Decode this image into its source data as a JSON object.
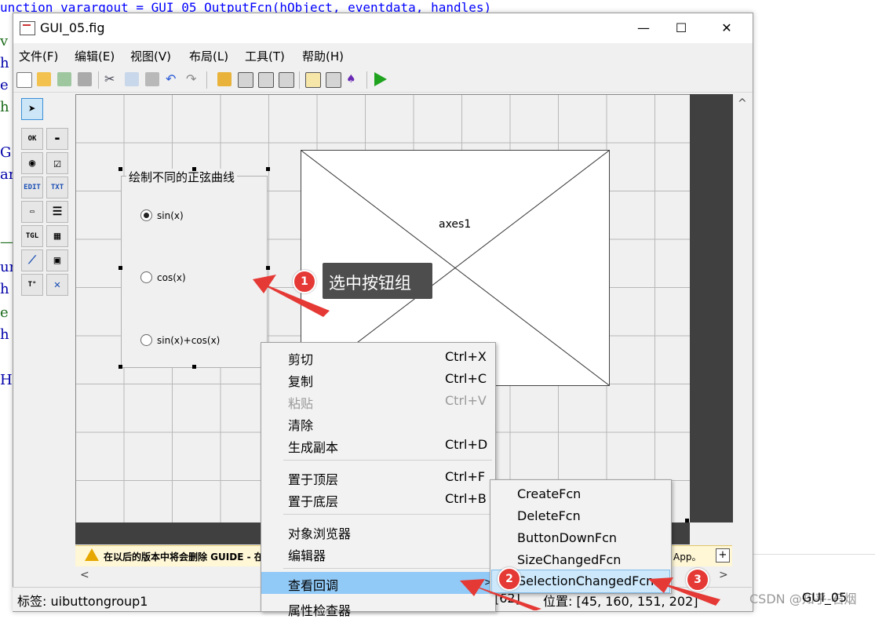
{
  "background_code": {
    "top_line": "unction varargout = GUI_05_OutputFcn(hObject, eventdata, handles)",
    "left_chars": [
      "v",
      "h",
      "e",
      "h",
      "G",
      "ar",
      "—",
      "un",
      "h",
      "e",
      "h",
      "H"
    ]
  },
  "window": {
    "title": "GUI_05.fig",
    "controls": {
      "minimize": "—",
      "maximize": "☐",
      "close": "✕"
    }
  },
  "menubar": {
    "items": [
      "文件(F)",
      "编辑(E)",
      "视图(V)",
      "布局(L)",
      "工具(T)",
      "帮助(H)"
    ]
  },
  "toolbar": {
    "buttons": [
      "new-icon",
      "open-icon",
      "save-as-icon",
      "save-icon",
      "cut-icon",
      "copy-icon",
      "paste-icon",
      "undo-icon",
      "redo-icon",
      "align-icon",
      "menu-editor-icon",
      "tab-order-icon",
      "toolbar-editor-icon",
      "editor-icon",
      "property-inspector-icon",
      "object-browser-icon",
      "run-icon"
    ]
  },
  "palette": {
    "tools": [
      "select",
      "OK",
      "slider",
      "radio",
      "checkbox",
      "EDIT",
      "TXT",
      "popup",
      "listbox",
      "TGL",
      "table",
      "axes",
      "panel",
      "buttongroup",
      "activex"
    ]
  },
  "buttongroup": {
    "title": "绘制不同的正弦曲线",
    "options": [
      {
        "label": "sin(x)",
        "selected": true
      },
      {
        "label": "cos(x)",
        "selected": false
      },
      {
        "label": "sin(x)+cos(x)",
        "selected": false
      }
    ]
  },
  "axes": {
    "label": "axes1"
  },
  "warning": {
    "text": "在以后的版本中将会删除 GUIDE - 在",
    "tail": "App。",
    "plus": "+"
  },
  "statusbar": {
    "tag": "标签: uibuttongroup1",
    "current_snippet": "[62]",
    "position": "位置: [45, 160, 151, 202]"
  },
  "context_menu": {
    "groups": [
      [
        {
          "label": "剪切",
          "key": "Ctrl+X",
          "disabled": false
        },
        {
          "label": "复制",
          "key": "Ctrl+C",
          "disabled": false
        },
        {
          "label": "粘贴",
          "key": "Ctrl+V",
          "disabled": true
        },
        {
          "label": "清除",
          "key": "",
          "disabled": false
        },
        {
          "label": "生成副本",
          "key": "Ctrl+D",
          "disabled": false
        }
      ],
      [
        {
          "label": "置于顶层",
          "key": "Ctrl+F",
          "disabled": false
        },
        {
          "label": "置于底层",
          "key": "Ctrl+B",
          "disabled": false
        }
      ],
      [
        {
          "label": "对象浏览器",
          "key": "",
          "disabled": false
        },
        {
          "label": "编辑器",
          "key": "",
          "disabled": false
        }
      ],
      [
        {
          "label": "查看回调",
          "key": "",
          "disabled": false,
          "highlighted": true,
          "submenu": ">"
        },
        {
          "label": "属性检查器",
          "key": "",
          "disabled": false
        }
      ]
    ]
  },
  "callback_submenu": {
    "items": [
      {
        "label": "CreateFcn",
        "highlighted": false
      },
      {
        "label": "DeleteFcn",
        "highlighted": false
      },
      {
        "label": "ButtonDownFcn",
        "highlighted": false
      },
      {
        "label": "SizeChangedFcn",
        "highlighted": false
      },
      {
        "label": "SelectionChangedFcn",
        "highlighted": true
      }
    ]
  },
  "annotations": {
    "callout_text": "选中按钮组",
    "badges": [
      "1",
      "2",
      "3"
    ],
    "arrow_color": "#e53935"
  },
  "watermark": "CSDN @知乎-石烟",
  "bottom_right_label": "GUI_05",
  "colors": {
    "menu_highlight": "#91c9f7",
    "submenu_highlight": "#cde8fb",
    "badge": "#e53935",
    "run": "#1fa31f"
  }
}
